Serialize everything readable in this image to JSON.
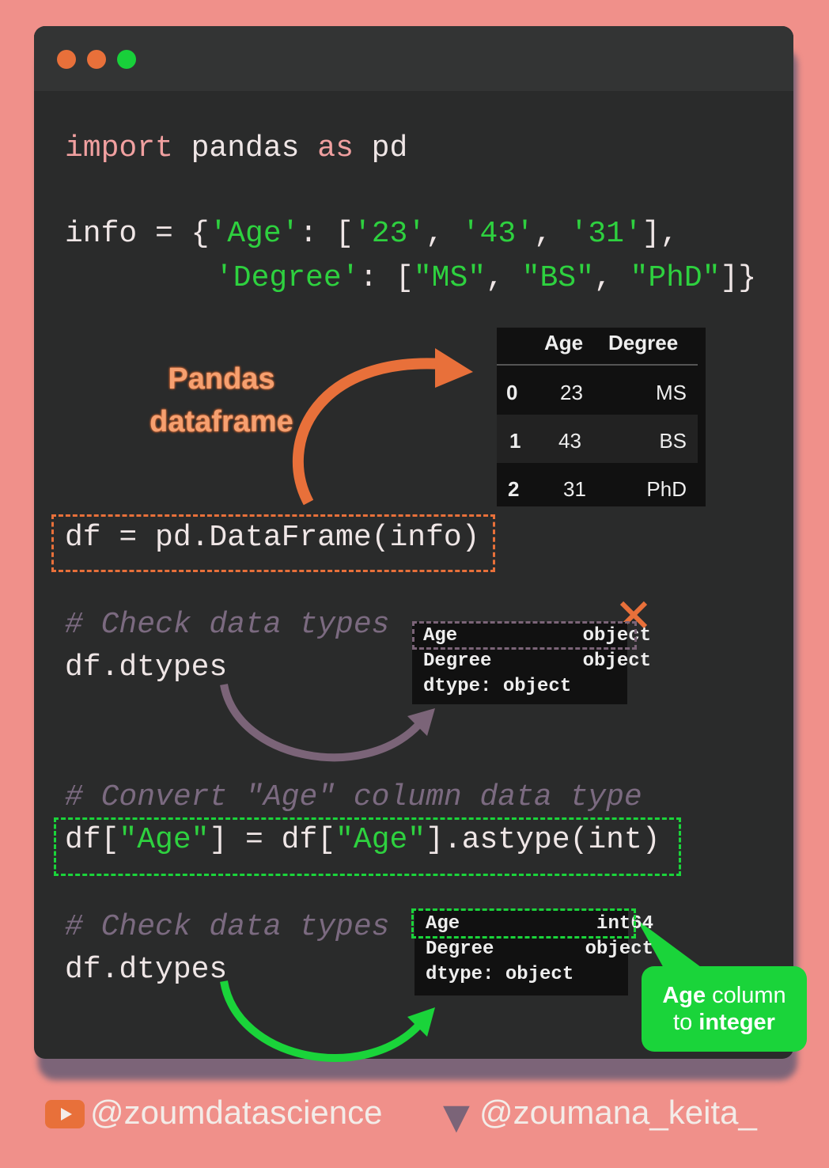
{
  "window_controls": {
    "colors": [
      "#e8703a",
      "#e8703a",
      "#18d03a"
    ]
  },
  "code": {
    "import": {
      "kw1": "import",
      "mod": " pandas ",
      "kw2": "as",
      "alias": " pd"
    },
    "info_line1": {
      "a": "info = {",
      "b": "'Age'",
      "c": ": [",
      "d": "'23'",
      "e": ", ",
      "f": "'43'",
      "g": ", ",
      "h": "'31'",
      "i": "],"
    },
    "info_line2": {
      "b": "'Degree'",
      "c": ": [",
      "d": "\"MS\"",
      "e": ", ",
      "f": "\"BS\"",
      "g": ", ",
      "h": "\"PhD\"",
      "i": "]}"
    },
    "df_line": "df = pd.DataFrame(info)",
    "comment1": "# Check data types",
    "dtypes1": "df.dtypes",
    "comment2": "# Convert \"Age\" column data type",
    "astype": {
      "a": "df[",
      "b": "\"Age\"",
      "c": "] = df[",
      "d": "\"Age\"",
      "e": "].astype(int)"
    },
    "comment3": "# Check data types",
    "dtypes2": "df.dtypes"
  },
  "annotation": {
    "line1": "Pandas",
    "line2": "dataframe"
  },
  "dataframe": {
    "columns": [
      "Age",
      "Degree"
    ],
    "rows": [
      {
        "index": "0",
        "age": "23",
        "degree": "MS"
      },
      {
        "index": "1",
        "age": "43",
        "degree": "BS"
      },
      {
        "index": "2",
        "age": "31",
        "degree": "PhD"
      }
    ]
  },
  "dtypes_before": [
    "Age           object",
    "Degree        object",
    "dtype: object"
  ],
  "dtypes_after": [
    "Age            int64",
    "Degree        object",
    "dtype: object"
  ],
  "callout": {
    "bold1": "Age",
    "text1": " column",
    "text2": "to ",
    "bold2": "integer"
  },
  "footer": {
    "youtube": "@zoumdatascience",
    "twitter": "@zoumana_keita_"
  }
}
